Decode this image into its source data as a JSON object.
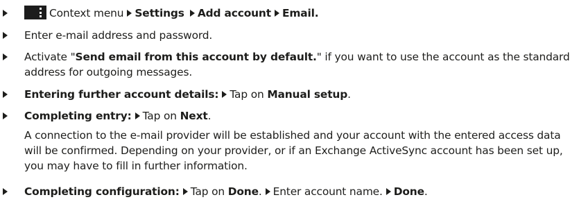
{
  "steps": [
    {
      "menu_label": "Context menu",
      "settings": "Settings",
      "add_account": "Add account",
      "email": "Email."
    },
    {
      "text": "Enter e-mail address and password."
    },
    {
      "pre": "Activate \"",
      "bold": "Send email from this account by default.",
      "post": "\" if you want to use the account as the standard address for outgoing messages."
    },
    {
      "bold": "Entering further account details:",
      "mid": "Tap on",
      "bold2": "Manual setup",
      "end": "."
    },
    {
      "bold": "Completing entry:",
      "mid": "Tap on",
      "bold2": "Next",
      "end": "."
    },
    {
      "bold": "Completing configuration:",
      "tap": "Tap on",
      "done": "Done",
      "sep": ".",
      "enter": "Enter account name.",
      "done2": "Done",
      "end": "."
    }
  ],
  "note": "A connection to the e-mail provider will be established and your account with the entered access data will be confirmed. Depending on your provider, or if an Exchange ActiveSync account has been set up, you may have to fill in further information.",
  "icons": {
    "bullet": "triangle-bullet-icon",
    "context_menu": "context-menu-icon"
  }
}
